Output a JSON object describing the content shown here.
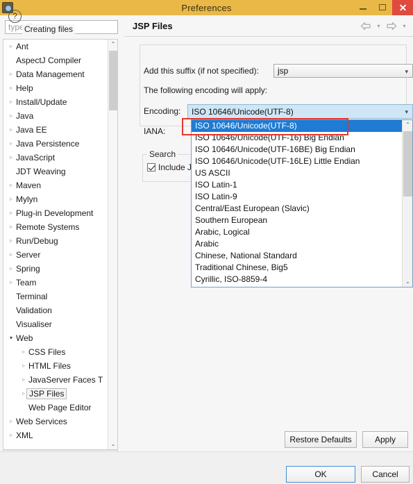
{
  "window": {
    "title": "Preferences",
    "icon": "eclipse-icon",
    "controls": {
      "minimize": "minimize-button",
      "maximize": "maximize-button",
      "close": "close-button"
    }
  },
  "sidebar": {
    "filter": {
      "placeholder": "type filter text",
      "value": ""
    },
    "items": [
      {
        "label": "Ant",
        "arrow": "▹",
        "indent": 0,
        "selected": false
      },
      {
        "label": "AspectJ Compiler",
        "arrow": "",
        "indent": 0,
        "selected": false
      },
      {
        "label": "Data Management",
        "arrow": "▹",
        "indent": 0,
        "selected": false
      },
      {
        "label": "Help",
        "arrow": "▹",
        "indent": 0,
        "selected": false
      },
      {
        "label": "Install/Update",
        "arrow": "▹",
        "indent": 0,
        "selected": false
      },
      {
        "label": "Java",
        "arrow": "▹",
        "indent": 0,
        "selected": false
      },
      {
        "label": "Java EE",
        "arrow": "▹",
        "indent": 0,
        "selected": false
      },
      {
        "label": "Java Persistence",
        "arrow": "▹",
        "indent": 0,
        "selected": false
      },
      {
        "label": "JavaScript",
        "arrow": "▹",
        "indent": 0,
        "selected": false
      },
      {
        "label": "JDT Weaving",
        "arrow": "",
        "indent": 0,
        "selected": false
      },
      {
        "label": "Maven",
        "arrow": "▹",
        "indent": 0,
        "selected": false
      },
      {
        "label": "Mylyn",
        "arrow": "▹",
        "indent": 0,
        "selected": false
      },
      {
        "label": "Plug-in Development",
        "arrow": "▹",
        "indent": 0,
        "selected": false
      },
      {
        "label": "Remote Systems",
        "arrow": "▹",
        "indent": 0,
        "selected": false
      },
      {
        "label": "Run/Debug",
        "arrow": "▹",
        "indent": 0,
        "selected": false
      },
      {
        "label": "Server",
        "arrow": "▹",
        "indent": 0,
        "selected": false
      },
      {
        "label": "Spring",
        "arrow": "▹",
        "indent": 0,
        "selected": false
      },
      {
        "label": "Team",
        "arrow": "▹",
        "indent": 0,
        "selected": false
      },
      {
        "label": "Terminal",
        "arrow": "",
        "indent": 0,
        "selected": false
      },
      {
        "label": "Validation",
        "arrow": "",
        "indent": 0,
        "selected": false
      },
      {
        "label": "Visualiser",
        "arrow": "",
        "indent": 0,
        "selected": false
      },
      {
        "label": "Web",
        "arrow": "▾",
        "indent": 0,
        "selected": false,
        "expanded": true
      },
      {
        "label": "CSS Files",
        "arrow": "▹",
        "indent": 1,
        "selected": false
      },
      {
        "label": "HTML Files",
        "arrow": "▹",
        "indent": 1,
        "selected": false
      },
      {
        "label": "JavaServer Faces T",
        "arrow": "▹",
        "indent": 1,
        "selected": false
      },
      {
        "label": "JSP Files",
        "arrow": "▹",
        "indent": 1,
        "selected": true
      },
      {
        "label": "Web Page Editor",
        "arrow": "",
        "indent": 1,
        "selected": false
      },
      {
        "label": "Web Services",
        "arrow": "▹",
        "indent": 0,
        "selected": false
      },
      {
        "label": "XML",
        "arrow": "▹",
        "indent": 0,
        "selected": false
      }
    ],
    "scrollbar": {
      "up": "⌃",
      "down": "⌄",
      "left": "‹",
      "right": "›"
    }
  },
  "page": {
    "title": "JSP Files",
    "nav": {
      "back": "back-arrow",
      "forward": "forward-arrow",
      "caret": "▾"
    },
    "group_creating_files": {
      "label": "Creating files",
      "suffix_label": "Add this suffix (if not specified):",
      "suffix_value": "jsp",
      "encoding_note": "The following encoding will apply:",
      "encoding_label": "Encoding:",
      "encoding_value": "ISO 10646/Unicode(UTF-8)",
      "iana_label": "IANA:"
    },
    "group_search": {
      "label": "Search",
      "checkbox_label": "Include J",
      "checked": true
    },
    "dropdown": {
      "open": true,
      "selected_index": 0,
      "options": [
        "ISO 10646/Unicode(UTF-8)",
        "ISO 10646/Unicode(UTF-16) Big Endian",
        "ISO 10646/Unicode(UTF-16BE) Big Endian",
        "ISO 10646/Unicode(UTF-16LE) Little Endian",
        "US ASCII",
        "ISO Latin-1",
        "ISO Latin-9",
        "Central/East European (Slavic)",
        "Southern European",
        "Arabic, Logical",
        "Arabic",
        "Chinese, National Standard",
        "Traditional Chinese, Big5",
        "Cyrillic, ISO-8859-4"
      ]
    },
    "restore_defaults_label": "Restore Defaults",
    "apply_label": "Apply"
  },
  "footer": {
    "help": "?",
    "ok_label": "OK",
    "cancel_label": "Cancel"
  },
  "colors": {
    "titlebar": "#e9b847",
    "close": "#e04a3f",
    "selection": "#1f7bd4",
    "annotation": "#e8352a",
    "focus": "#3d8fd4"
  },
  "caret_glyph": "▾"
}
